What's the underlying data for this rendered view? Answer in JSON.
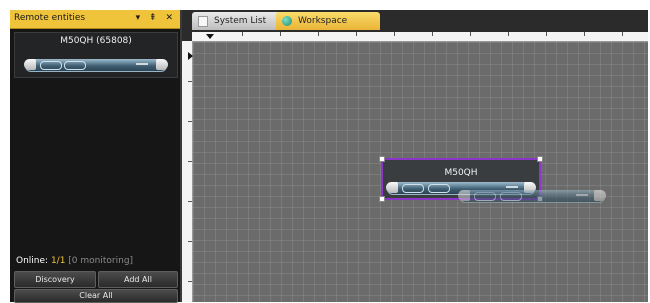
{
  "panel": {
    "title": "Remote entities",
    "controls": "▾ ⇞ ✕",
    "device_name": "M50QH (65808)",
    "online_label": "Online:",
    "online_count": "1/1",
    "monitoring": "[0 monitoring]"
  },
  "buttons": {
    "discovery": "Discovery",
    "add_all": "Add All",
    "clear_all": "Clear All"
  },
  "tabs": [
    {
      "label": "System List",
      "active": false
    },
    {
      "label": "Workspace",
      "active": true
    }
  ],
  "workspace": {
    "device_name": "M50QH"
  },
  "colors": {
    "accent": "#f0c43a",
    "selection": "#8b36c8",
    "canvas": "#6b6b6b"
  }
}
